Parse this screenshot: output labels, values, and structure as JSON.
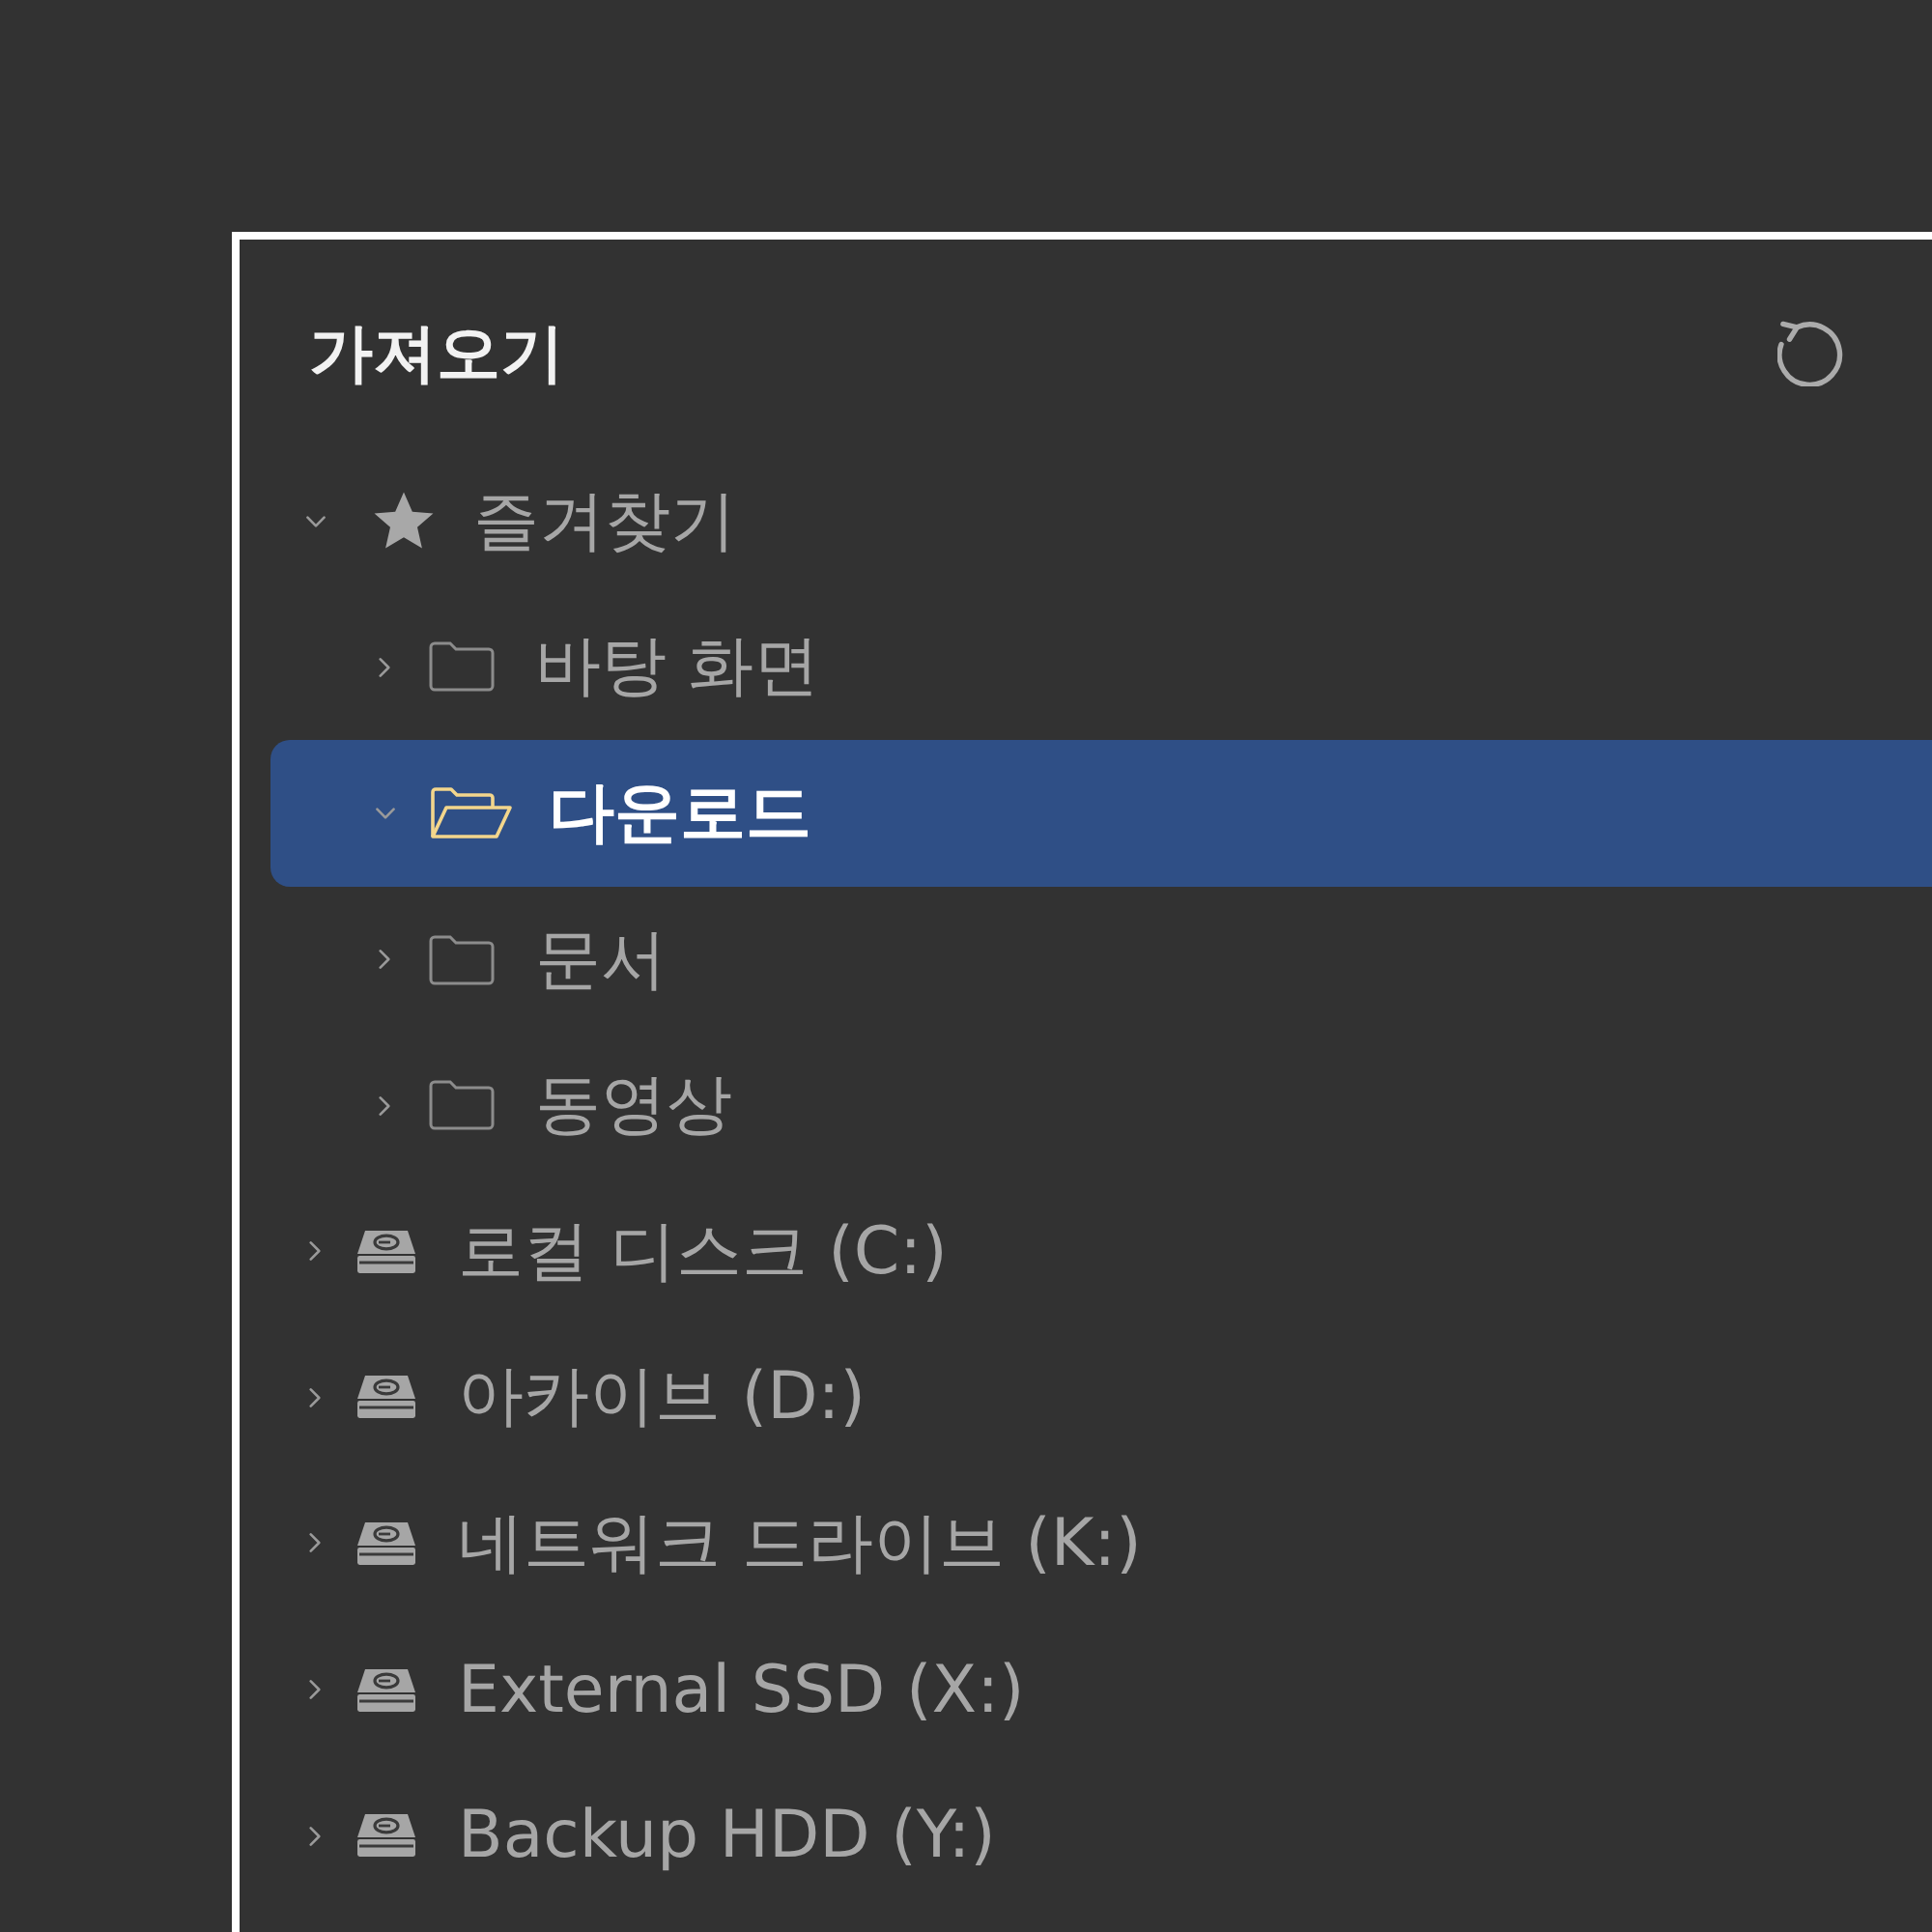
{
  "panel": {
    "title": "가져오기"
  },
  "tree": [
    {
      "label": "즐겨찾기",
      "kind": "favorites",
      "expanded": true,
      "selected": false,
      "children": [
        {
          "label": "바탕 화면",
          "kind": "folder",
          "expanded": false,
          "selected": false
        },
        {
          "label": "다운로드",
          "kind": "folder",
          "expanded": true,
          "selected": true
        },
        {
          "label": "문서",
          "kind": "folder",
          "expanded": false,
          "selected": false
        },
        {
          "label": "동영상",
          "kind": "folder",
          "expanded": false,
          "selected": false
        }
      ]
    },
    {
      "label": "로컬 디스크 (C:)",
      "kind": "drive",
      "expanded": false,
      "selected": false
    },
    {
      "label": "아카이브 (D:)",
      "kind": "drive",
      "expanded": false,
      "selected": false
    },
    {
      "label": "네트워크 드라이브 (K:)",
      "kind": "drive",
      "expanded": false,
      "selected": false
    },
    {
      "label": "External SSD (X:)",
      "kind": "drive",
      "expanded": false,
      "selected": false
    },
    {
      "label": "Backup HDD (Y:)",
      "kind": "drive",
      "expanded": false,
      "selected": false
    }
  ]
}
